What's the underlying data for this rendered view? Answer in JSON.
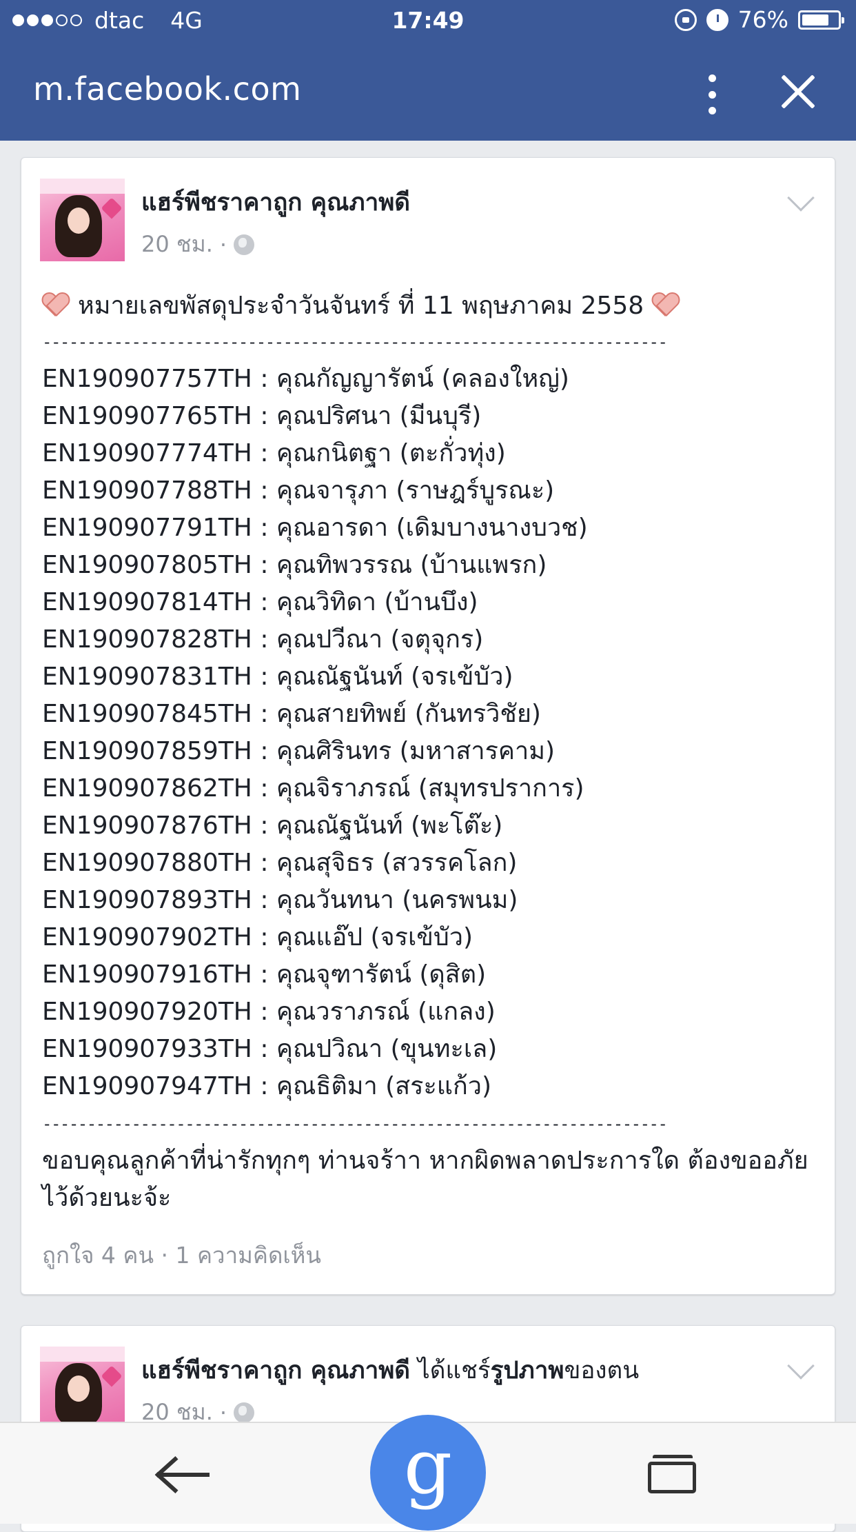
{
  "status_bar": {
    "carrier": "dtac",
    "network": "4G",
    "time": "17:49",
    "battery": "76%",
    "battery_level": 0.76,
    "signal_strength": 3,
    "signal_max": 5
  },
  "browser": {
    "url": "m.facebook.com"
  },
  "post1": {
    "author": "แฮร์พีชราคาถูก คุณภาพดี",
    "time": "20 ชม.",
    "separator": "·",
    "headline": "หมายเลขพัสดุประจำวันจันทร์ ที่ 11 พฤษภาคม 2558",
    "divider": "----------------------------------------------------------------------",
    "parcels": [
      "EN190907757TH : คุณกัญญารัตน์ (คลองใหญ่)",
      "EN190907765TH : คุณปริศนา (มีนบุรี)",
      "EN190907774TH : คุณกนิตฐา (ตะกั่วทุ่ง)",
      "EN190907788TH : คุณจารุภา (ราษฎร์บูรณะ)",
      "EN190907791TH : คุณอารดา (เดิมบางนางบวช)",
      "EN190907805TH : คุณทิพวรรณ (บ้านแพรก)",
      "EN190907814TH : คุณวิทิดา (บ้านบึง)",
      "EN190907828TH : คุณปวีณา (จตุจุกร)",
      "EN190907831TH : คุณณัฐนันท์ (จรเข้บัว)",
      "EN190907845TH : คุณสายทิพย์ (กันทรวิชัย)",
      "EN190907859TH : คุณศิรินทร (มหาสารคาม)",
      "EN190907862TH : คุณจิราภรณ์ (สมุทรปราการ)",
      "EN190907876TH : คุณณัฐนันท์ (พะโต๊ะ)",
      "EN190907880TH : คุณสุจิธร (สวรรคโลก)",
      "EN190907893TH : คุณวันทนา (นครพนม)",
      "EN190907902TH : คุณแอ๊ป (จรเข้บัว)",
      "EN190907916TH : คุณจุฑารัตน์ (ดุสิต)",
      "EN190907920TH : คุณวราภรณ์ (แกลง)",
      "EN190907933TH : คุณปวิณา (ขุนทะเล)",
      "EN190907947TH : คุณธิติมา (สระแก้ว)"
    ],
    "thanks": "ขอบคุณลูกค้าที่น่ารักทุกๆ ท่านจร้าา หากผิดพลาดประการใด ต้องขออภัยไว้ด้วยนะจ้ะ",
    "stats": "ถูกใจ 4 คน · 1 ความคิดเห็น"
  },
  "post2": {
    "author": "แฮร์พีชราคาถูก คุณภาพดี",
    "action": " ได้แชร์",
    "action_bold": "รูปภาพ",
    "action_tail": "ของตน",
    "time": "20 ชม.",
    "separator": "·"
  },
  "bottom_nav": {
    "google_glyph": "g"
  },
  "colors": {
    "facebook_blue": "#3b5998",
    "google_blue": "#4a86e8"
  },
  "icons": [
    "lock-rotation-icon",
    "alarm-icon",
    "battery-icon",
    "more-vert-icon",
    "close-icon",
    "globe-icon",
    "chevron-down-icon",
    "heart-icon",
    "back-arrow-icon",
    "tabs-icon"
  ]
}
